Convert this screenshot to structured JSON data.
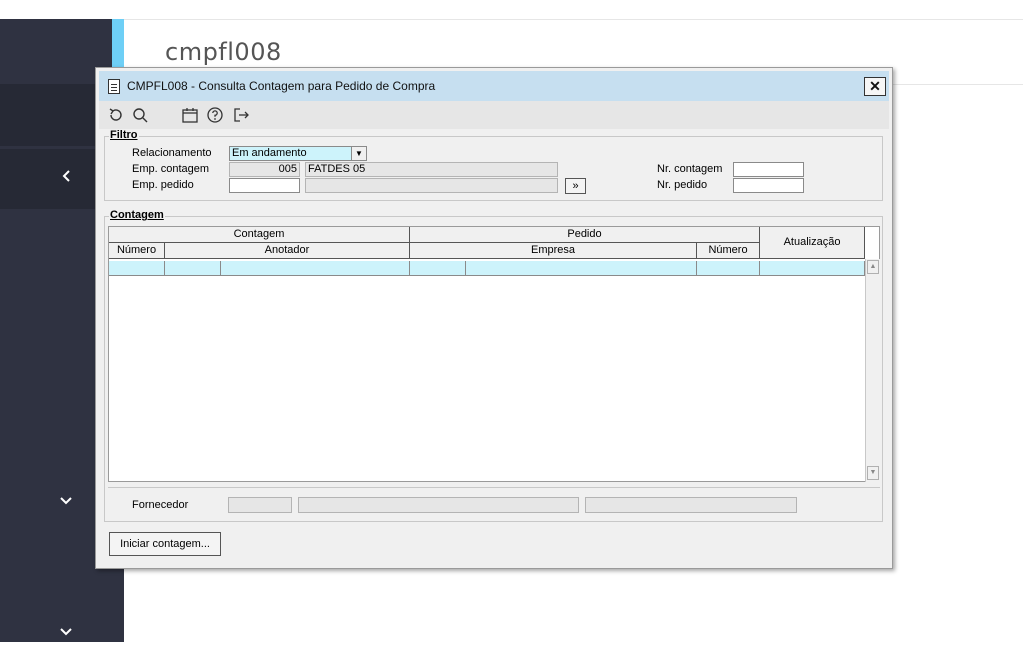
{
  "background": {
    "page_title": "cmpfl008"
  },
  "dialog": {
    "title": "CMPFL008 - Consulta Contagem para Pedido de Compra",
    "close_label": "✕",
    "filtro": {
      "group_label": "Filtro",
      "relacionamento_label": "Relacionamento",
      "relacionamento_value": "Em andamento",
      "emp_contagem_label": "Emp. contagem",
      "emp_contagem_code": "005",
      "emp_contagem_name": "FATDES 05",
      "emp_pedido_label": "Emp. pedido",
      "emp_pedido_value": "",
      "lookup_button": "»",
      "nr_contagem_label": "Nr. contagem",
      "nr_contagem_value": "",
      "nr_pedido_label": "Nr. pedido",
      "nr_pedido_value": ""
    },
    "contagem": {
      "group_label": "Contagem",
      "headers": {
        "contagem": "Contagem",
        "pedido": "Pedido",
        "atualizacao": "Atualização",
        "numero": "Número",
        "anotador": "Anotador",
        "empresa": "Empresa",
        "numero2": "Número"
      },
      "fornecedor_label": "Fornecedor"
    },
    "iniciar_button": "Iniciar contagem..."
  },
  "colors": {
    "titlebar": "#c6dff0",
    "selection": "#cdf3fb",
    "sidebar": "#2f3241",
    "sidebar_accent": "#6ecff6"
  }
}
